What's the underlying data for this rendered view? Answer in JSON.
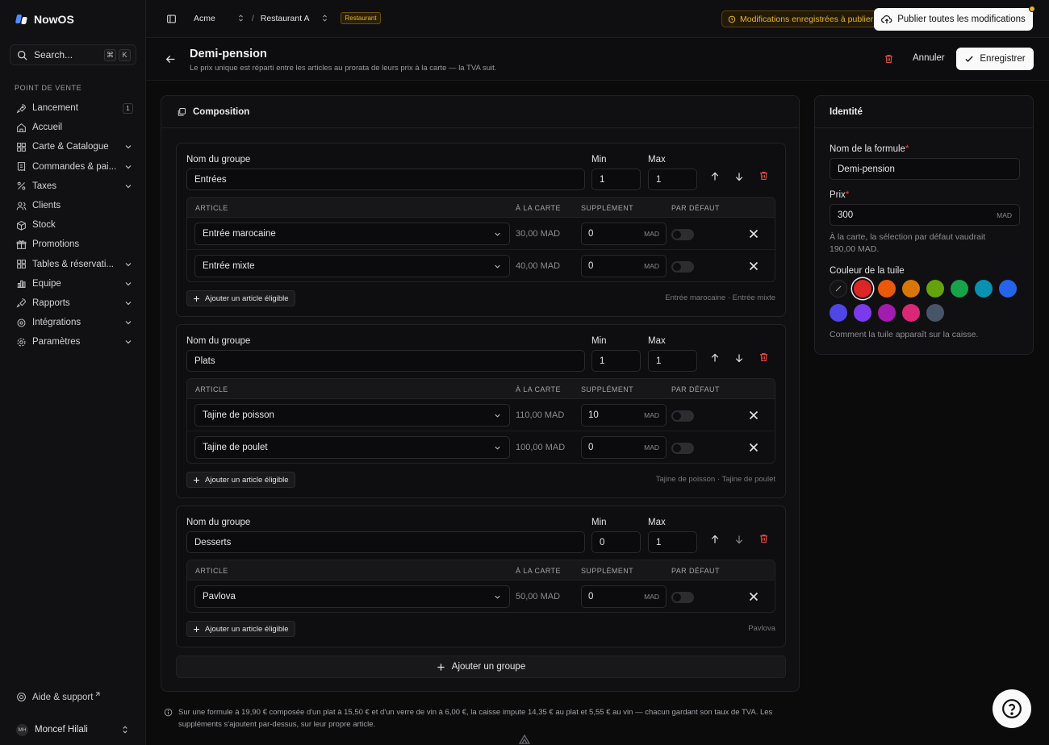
{
  "app": {
    "name": "NowOS"
  },
  "search": {
    "label": "Search...",
    "kbd": [
      "⌘",
      "K"
    ]
  },
  "sidebar": {
    "section": "POINT DE VENTE",
    "items": [
      {
        "label": "Lancement",
        "badge": "1"
      },
      {
        "label": "Accueil"
      },
      {
        "label": "Carte & Catalogue"
      },
      {
        "label": "Commandes & pai..."
      },
      {
        "label": "Taxes"
      },
      {
        "label": "Clients"
      },
      {
        "label": "Stock"
      },
      {
        "label": "Promotions"
      },
      {
        "label": "Tables & réservati..."
      },
      {
        "label": "Équipe"
      },
      {
        "label": "Rapports"
      },
      {
        "label": "Intégrations"
      },
      {
        "label": "Paramètres"
      }
    ],
    "help": "Aide & support",
    "user": {
      "initials": "MH",
      "name": "Moncef Hilali"
    }
  },
  "topbar": {
    "org": "Acme",
    "location": "Restaurant A",
    "tag": "Restaurant",
    "pending": "Modifications enregistrées à publier",
    "publish": "Publier toutes les modifications"
  },
  "page": {
    "title": "Demi-pension",
    "subtitle": "Le prix unique est réparti entre les articles au prorata de leurs prix à la carte — la TVA suit.",
    "cancel": "Annuler",
    "save": "Enregistrer"
  },
  "composition": {
    "title": "Composition",
    "labels": {
      "group_name": "Nom du groupe",
      "min": "Min",
      "max": "Max"
    },
    "columns": {
      "article": "ARTICLE",
      "carte": "À LA CARTE",
      "supplement": "SUPPLÉMENT",
      "default": "PAR DÉFAUT"
    },
    "unit": "MAD",
    "add_item": "Ajouter un article éligible",
    "add_group": "Ajouter un groupe",
    "groups": [
      {
        "name": "Entrées",
        "min": "1",
        "max": "1",
        "items": [
          {
            "article": "Entrée marocaine",
            "price": "30,00 MAD",
            "supplement": "0"
          },
          {
            "article": "Entrée mixte",
            "price": "40,00 MAD",
            "supplement": "0"
          }
        ],
        "summary": "Entrée marocaine · Entrée mixte"
      },
      {
        "name": "Plats",
        "min": "1",
        "max": "1",
        "items": [
          {
            "article": "Tajine de poisson",
            "price": "110,00 MAD",
            "supplement": "10"
          },
          {
            "article": "Tajine de poulet",
            "price": "100,00 MAD",
            "supplement": "0"
          }
        ],
        "summary": "Tajine de poisson · Tajine de poulet"
      },
      {
        "name": "Desserts",
        "min": "0",
        "max": "1",
        "items": [
          {
            "article": "Pavlova",
            "price": "50,00 MAD",
            "supplement": "0"
          }
        ],
        "summary": "Pavlova"
      }
    ]
  },
  "identity": {
    "title": "Identité",
    "name_label": "Nom de la formule",
    "name_value": "Demi-pension",
    "price_label": "Prix",
    "price_value": "300",
    "price_unit": "MAD",
    "price_hint": "À la carte, la sélection par défaut vaudrait 190,00 MAD.",
    "color_label": "Couleur de la tuile",
    "color_hint": "Comment la tuile apparaît sur la caisse.",
    "swatches": [
      "none",
      "#dc2626",
      "#ea580c",
      "#d97706",
      "#65a30d",
      "#16a34a",
      "#0891b2",
      "#2563eb",
      "#4f46e5",
      "#7c3aed",
      "#a21caf",
      "#db2777",
      "#475569"
    ],
    "selected_color": "#dc2626"
  },
  "footnote": "Sur une formule à 19,90 € composée d'un plat à 15,50 € et d'un verre de vin à 6,00 €, la caisse impute 14,35 € au plat et 5,55 € au vin — chacun gardant son taux de TVA. Les suppléments s'ajoutent par-dessus, sur leur propre article.",
  "colors": {
    "accent": "#e8b52b",
    "danger": "#e2483d",
    "background": "#0b0b0c"
  }
}
